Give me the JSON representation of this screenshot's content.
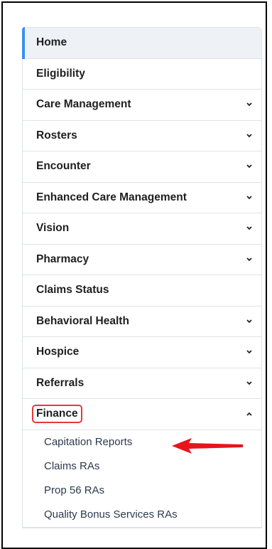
{
  "nav": {
    "items": [
      {
        "label": "Home",
        "chevron": "",
        "active": true
      },
      {
        "label": "Eligibility",
        "chevron": ""
      },
      {
        "label": "Care Management",
        "chevron": "down"
      },
      {
        "label": "Rosters",
        "chevron": "down"
      },
      {
        "label": "Encounter",
        "chevron": "down"
      },
      {
        "label": "Enhanced Care Management",
        "chevron": "down"
      },
      {
        "label": "Vision",
        "chevron": "down"
      },
      {
        "label": "Pharmacy",
        "chevron": "down"
      },
      {
        "label": "Claims Status",
        "chevron": ""
      },
      {
        "label": "Behavioral Health",
        "chevron": "down"
      },
      {
        "label": "Hospice",
        "chevron": "down"
      },
      {
        "label": "Referrals",
        "chevron": "down"
      }
    ],
    "finance": {
      "label": "Finance",
      "chevron": "up",
      "subitems": [
        "Capitation Reports",
        "Claims RAs",
        "Prop 56 RAs",
        "Quality Bonus Services RAs"
      ]
    }
  },
  "colors": {
    "accent": "#3d8ef0",
    "highlight": "#e53935",
    "text": "#1f1f1f",
    "subtext": "#2b3a4d"
  },
  "icons": {
    "chevron_down": "chevron-down-icon",
    "chevron_up": "chevron-up-icon",
    "annotation_arrow": "red-arrow-icon"
  }
}
